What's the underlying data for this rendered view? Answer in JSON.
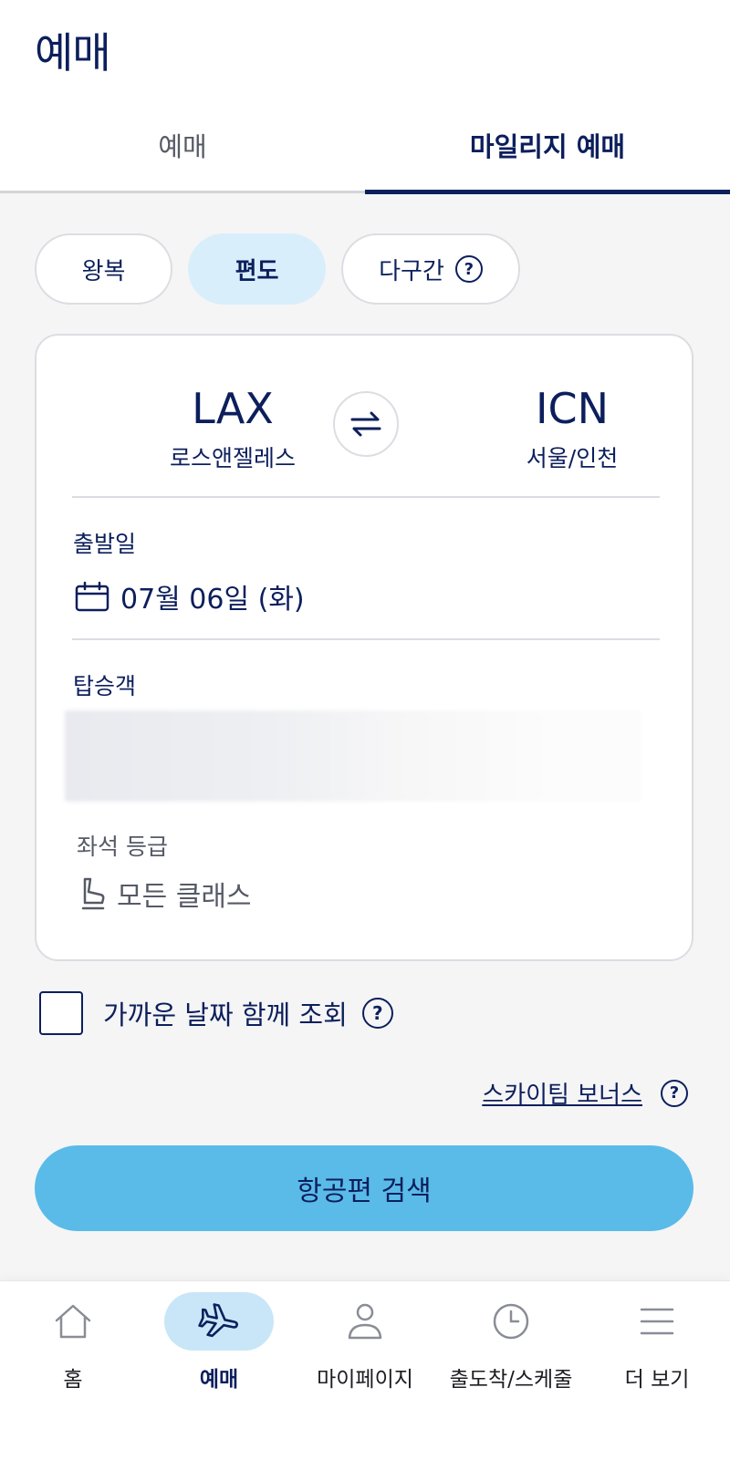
{
  "page_title": "예매",
  "tabs": [
    {
      "label": "예매",
      "active": false
    },
    {
      "label": "마일리지 예매",
      "active": true
    }
  ],
  "trip_types": {
    "round": "왕복",
    "oneway": "편도",
    "multi": "다구간",
    "selected": "편도"
  },
  "route": {
    "from": {
      "code": "LAX",
      "city": "로스앤젤레스"
    },
    "to": {
      "code": "ICN",
      "city": "서울/인천"
    }
  },
  "departure": {
    "label": "출발일",
    "value": "07월 06일 (화)"
  },
  "passengers": {
    "label": "탑승객"
  },
  "seat_class": {
    "label": "좌석 등급",
    "value": "모든 클래스"
  },
  "flexible_dates": {
    "label": "가까운 날짜 함께 조회",
    "checked": false
  },
  "help_symbol": "?",
  "bonus_link": "스카이팀 보너스",
  "search_button": "항공편 검색",
  "bottom_nav": [
    {
      "label": "홈",
      "icon": "home-icon",
      "active": false
    },
    {
      "label": "예매",
      "icon": "airplane-icon",
      "active": true
    },
    {
      "label": "마이페이지",
      "icon": "user-icon",
      "active": false
    },
    {
      "label": "출도착/스케줄",
      "icon": "clock-icon",
      "active": false
    },
    {
      "label": "더 보기",
      "icon": "menu-icon",
      "active": false
    }
  ],
  "colors": {
    "primary": "#0c1f5c",
    "accent": "#5abbe8",
    "selected_pill": "#d9eefb",
    "background": "#f5f5f6"
  }
}
